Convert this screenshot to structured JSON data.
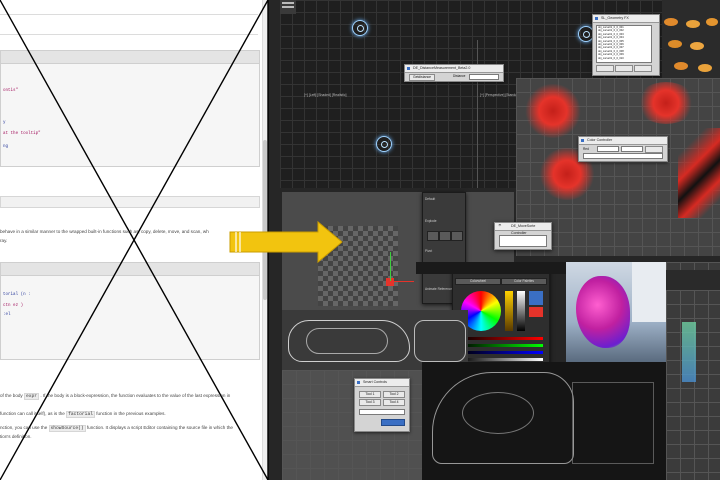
{
  "document": {
    "code_block_1": {
      "lines": [
        {
          "text": "ontis\"",
          "cls": "str"
        },
        {
          "text": "y",
          "cls": "kw"
        },
        {
          "text": "at the tooltip\"",
          "cls": "str"
        },
        {
          "text": "ng",
          "cls": "kw"
        }
      ]
    },
    "prose_1": "behave in a similar manner to the wrapped built-in functions such as, copy, delete, move, and scan, wh",
    "prose_1b": "ray.",
    "code_block_2": {
      "lines": [
        {
          "text": "torial (n :",
          "cls": "kw"
        },
        {
          "text": "ctn ez )",
          "cls": "str"
        },
        {
          "text": ":el",
          "cls": "kw"
        }
      ]
    },
    "prose_2a_pre": "of the body",
    "prose_2a_chip": "expr",
    "prose_2a_post": ". If the body is a block-expression, the function evaluates to the value of the last expression in",
    "prose_2b_pre": "function can call itself), as is the",
    "prose_2b_chip": "factorial",
    "prose_2b_post": "function in the previous examples.",
    "prose_2c_pre": "nction, you can use the",
    "prose_2c_chip": "showSource()",
    "prose_2c_post": "function. It displays a script Editor containing the source file in which the",
    "prose_2d": "tion's definition."
  },
  "collage": {
    "viewport_top_label": "[+] [Left] [Shaded] [Realistic]",
    "viewport_right_label": "[+] [Perspective] [Standard] [De",
    "distance_dialog": {
      "title": "DE_DistanceMeasurement_Beta2.0",
      "button": "Getdistance",
      "field_label": "Distance"
    },
    "geometry_list": {
      "title": "SL_Geometry FX",
      "items": [
        "obj_curve01_0_0_001",
        "obj_curve01_0_0_002",
        "obj_curve01_0_0_003",
        "obj_curve01_0_0_004",
        "obj_curve01_0_0_005",
        "obj_curve01_0_0_006",
        "obj_curve01_0_0_007",
        "obj_curve01_0_0_008",
        "obj_curve01_0_0_009",
        "obj_curve01_0_0_010"
      ]
    },
    "color_controller": {
      "title": "Color Controller",
      "label": "Red"
    },
    "ray_controller": {
      "title": "DE_MoveSorte Controller"
    },
    "side_panel": {
      "labels": [
        "Default",
        "Explode",
        "Pivot",
        "Animate Reference"
      ]
    },
    "color_picker": {
      "title": "Color picker",
      "tabs": [
        "Colorwheel",
        "Color Palettes"
      ]
    },
    "anim_dialog": {
      "title": "Smart Controls",
      "rows": [
        "Tool 1",
        "Tool 2",
        "Tool 3",
        "Tool 4"
      ]
    },
    "colors": {
      "accent_blue": "#3a6fc4",
      "red_particles": "#e5332a",
      "arrow_yellow": "#f2c40f"
    }
  },
  "icons": [
    "arrow-right-icon",
    "teapot-icon",
    "node-icon"
  ]
}
